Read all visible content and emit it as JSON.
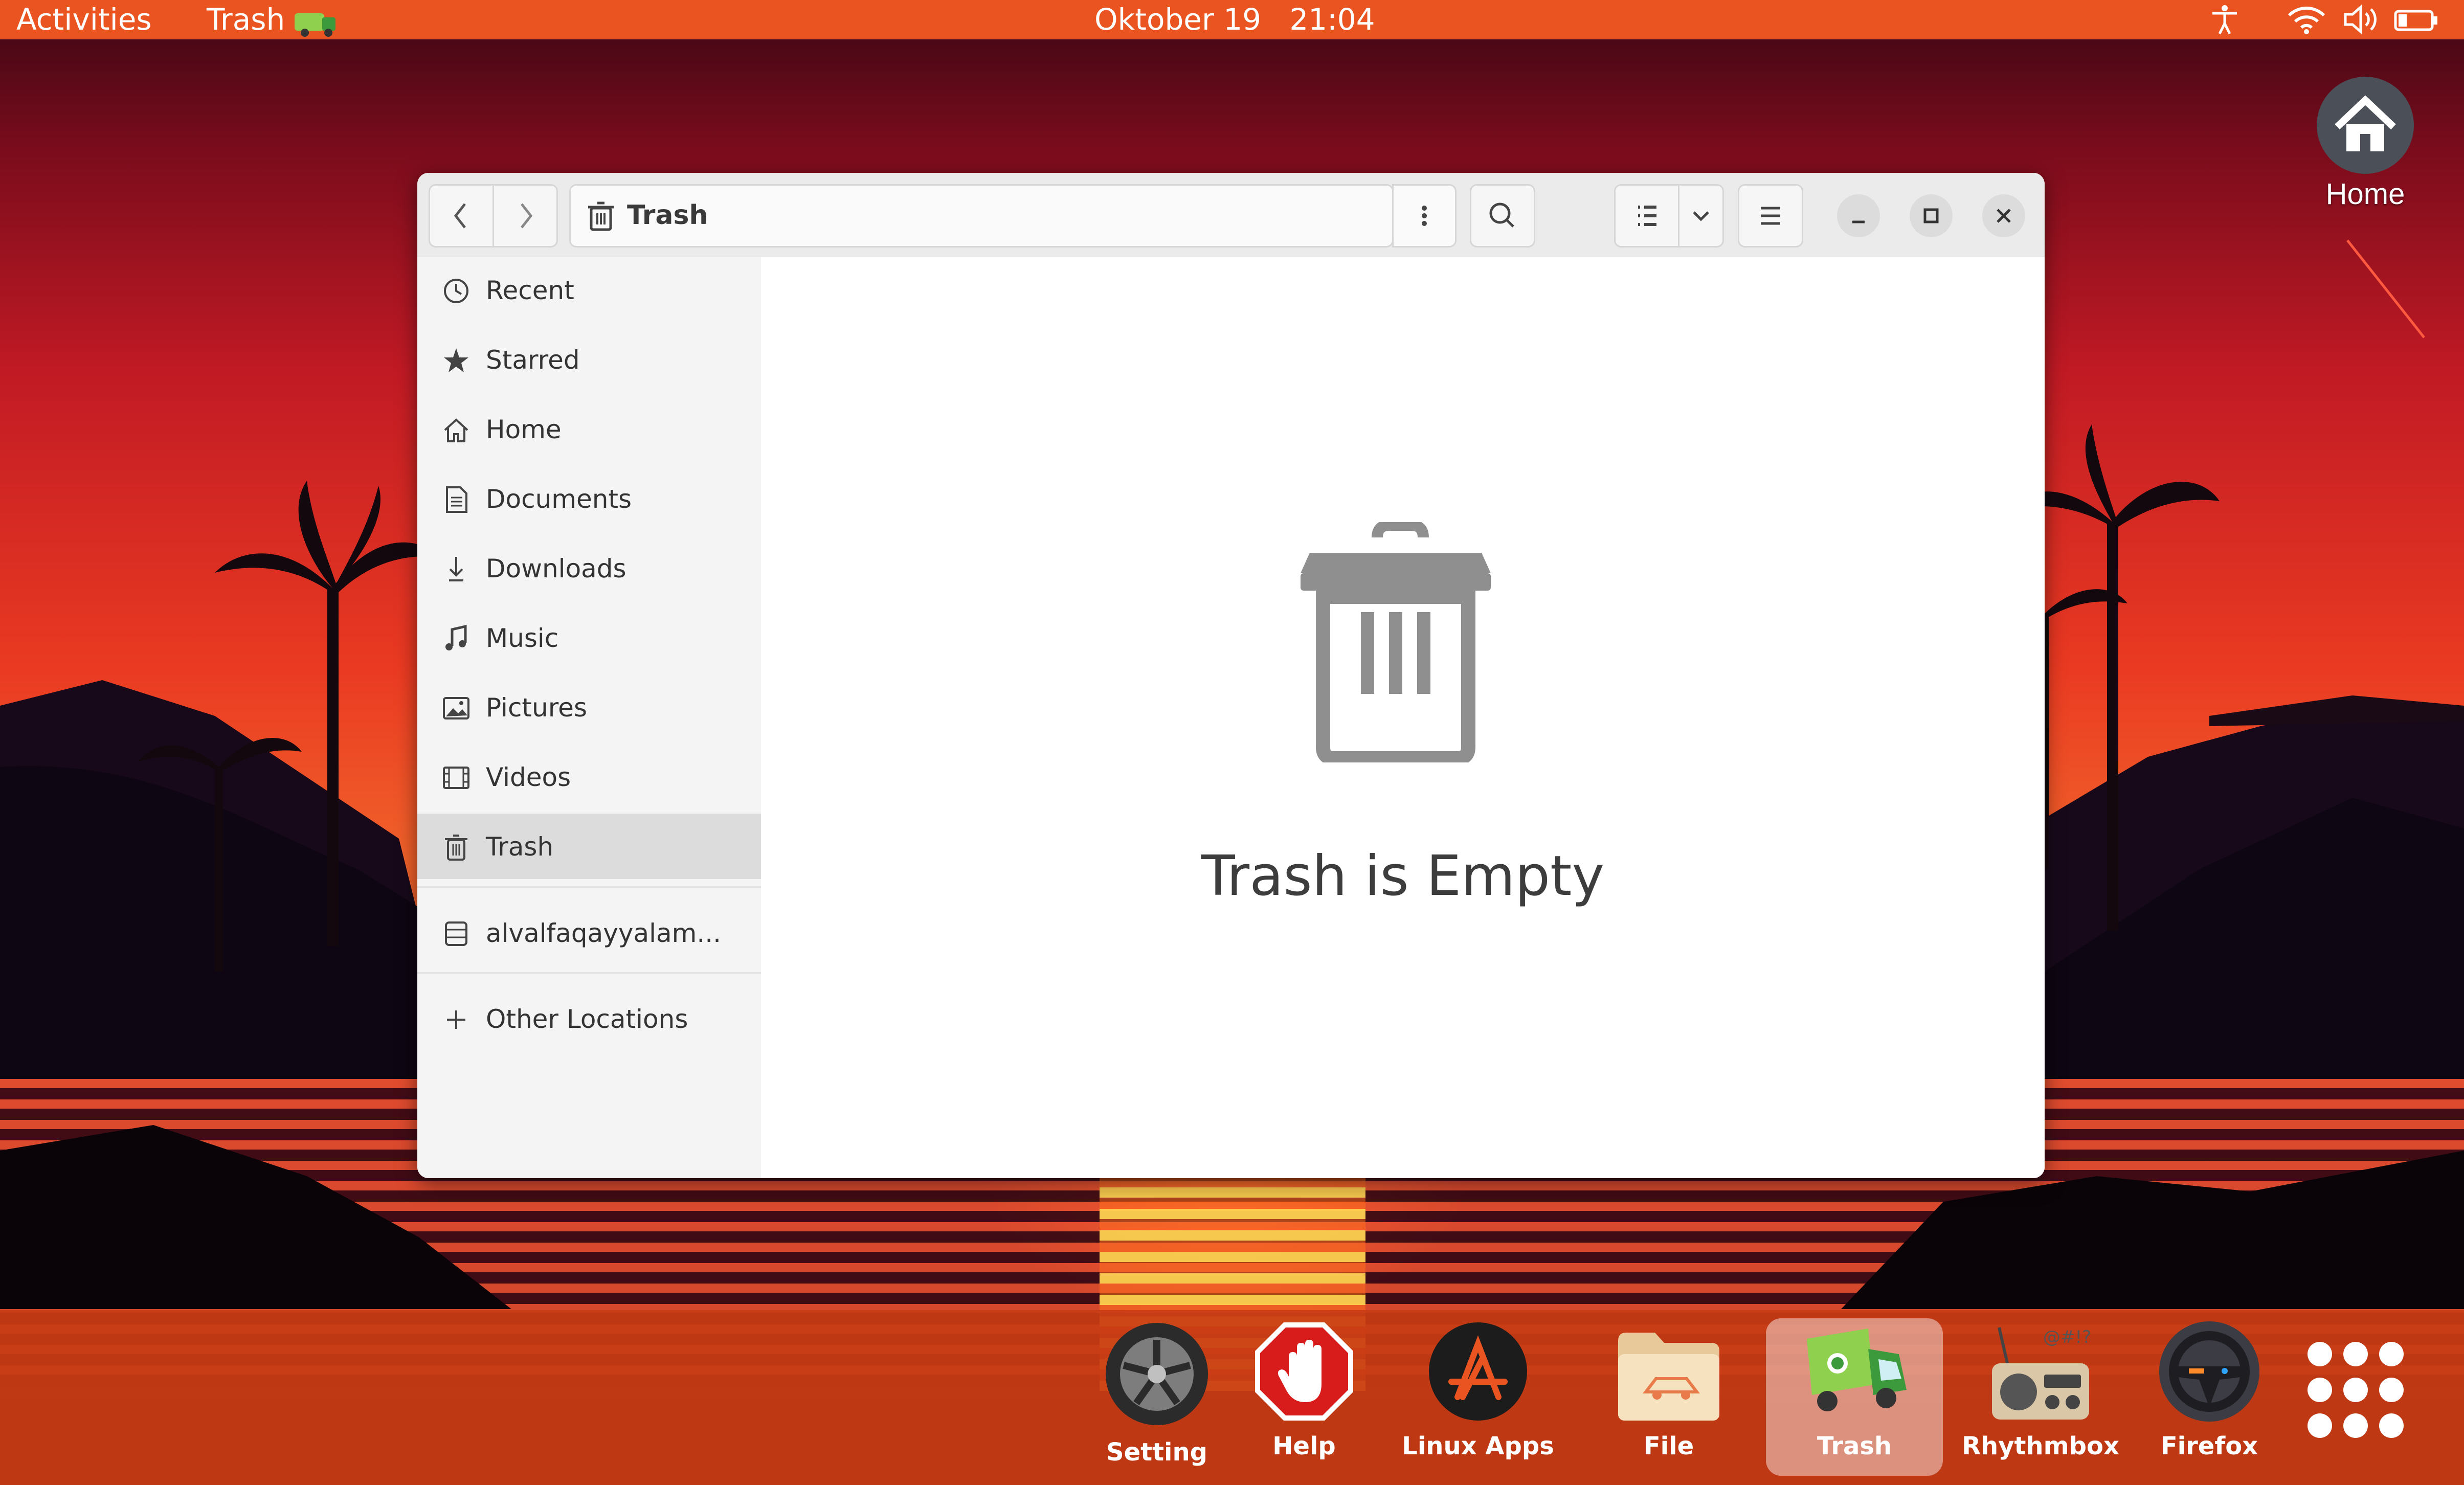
{
  "top_bar": {
    "activities": "Activities",
    "active_app": "Trash",
    "date": "Oktober 19",
    "time": "21:04",
    "status_icons": [
      "accessibility-icon",
      "wifi-icon",
      "volume-icon",
      "battery-icon"
    ],
    "color": "#e95420"
  },
  "desktop_icons": [
    {
      "label": "Home",
      "icon": "home-icon"
    }
  ],
  "window": {
    "path": "Trash",
    "nav": {
      "back": "chevron-left-icon",
      "forward": "chevron-right-icon"
    },
    "sidebar": {
      "items": [
        {
          "label": "Recent",
          "icon": "clock-icon"
        },
        {
          "label": "Starred",
          "icon": "star-icon"
        },
        {
          "label": "Home",
          "icon": "home-icon"
        },
        {
          "label": "Documents",
          "icon": "document-icon"
        },
        {
          "label": "Downloads",
          "icon": "download-icon"
        },
        {
          "label": "Music",
          "icon": "music-icon"
        },
        {
          "label": "Pictures",
          "icon": "picture-icon"
        },
        {
          "label": "Videos",
          "icon": "video-icon"
        },
        {
          "label": "Trash",
          "icon": "trash-icon",
          "active": true
        }
      ],
      "drive": {
        "label": "alvalfaqayyalam...",
        "icon": "drive-icon"
      },
      "other_locations": {
        "label": "Other Locations",
        "icon": "plus-icon"
      }
    },
    "empty_state": {
      "label": "Trash is Empty",
      "icon": "trash-icon"
    }
  },
  "dock": {
    "items": [
      {
        "label": "Setting",
        "icon": "wheel-icon"
      },
      {
        "label": "Help",
        "icon": "stop-hand-icon"
      },
      {
        "label": "Linux Apps",
        "icon": "app-store-icon"
      },
      {
        "label": "File",
        "icon": "folder-icon"
      },
      {
        "label": "Trash",
        "icon": "truck-icon",
        "running": true
      },
      {
        "label": "Rhythmbox",
        "icon": "radio-icon"
      },
      {
        "label": "Firefox",
        "icon": "steering-wheel-icon"
      }
    ],
    "app_grid_icon": "app-grid-icon"
  }
}
